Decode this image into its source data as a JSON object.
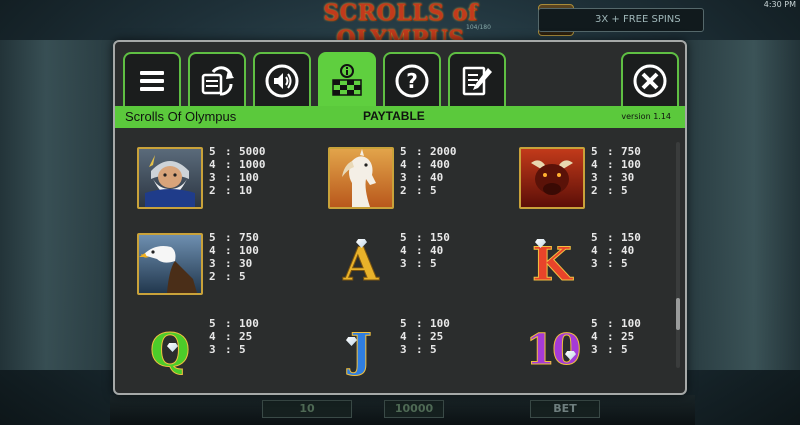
{
  "background": {
    "game_title": "SCROLLS of OLYMPUS",
    "counter": "104/180",
    "free_spins": "3X + FREE SPINS",
    "clock": "4:30 PM",
    "lines_value": "10",
    "credit_value": "10000",
    "bet_label": "BET"
  },
  "toolbar": {
    "menu": "menu-icon",
    "autoplay": "autoplay-icon",
    "sound": "sound-icon",
    "paytable": "paytable-icon",
    "help": "help-icon",
    "history": "history-icon",
    "close": "close-icon"
  },
  "header": {
    "game_name": "Scrolls Of Olympus",
    "section": "PAYTABLE",
    "version": "version 1.14"
  },
  "colors": {
    "accent_green": "#5bc93c",
    "modal_bg": "#2b2d2d",
    "frame_gold": "#c9a23a"
  },
  "paytable": [
    {
      "symbol": "zeus-icon",
      "pays": [
        {
          "count": "5",
          "value": "5000"
        },
        {
          "count": "4",
          "value": "1000"
        },
        {
          "count": "3",
          "value": "100"
        },
        {
          "count": "2",
          "value": "10"
        }
      ]
    },
    {
      "symbol": "pegasus-icon",
      "pays": [
        {
          "count": "5",
          "value": "2000"
        },
        {
          "count": "4",
          "value": "400"
        },
        {
          "count": "3",
          "value": "40"
        },
        {
          "count": "2",
          "value": "5"
        }
      ]
    },
    {
      "symbol": "bull-icon",
      "pays": [
        {
          "count": "5",
          "value": "750"
        },
        {
          "count": "4",
          "value": "100"
        },
        {
          "count": "3",
          "value": "30"
        },
        {
          "count": "2",
          "value": "5"
        }
      ]
    },
    {
      "symbol": "eagle-icon",
      "pays": [
        {
          "count": "5",
          "value": "750"
        },
        {
          "count": "4",
          "value": "100"
        },
        {
          "count": "3",
          "value": "30"
        },
        {
          "count": "2",
          "value": "5"
        }
      ]
    },
    {
      "symbol": "A",
      "pays": [
        {
          "count": "5",
          "value": "150"
        },
        {
          "count": "4",
          "value": "40"
        },
        {
          "count": "3",
          "value": "5"
        }
      ]
    },
    {
      "symbol": "K",
      "pays": [
        {
          "count": "5",
          "value": "150"
        },
        {
          "count": "4",
          "value": "40"
        },
        {
          "count": "3",
          "value": "5"
        }
      ]
    },
    {
      "symbol": "Q",
      "pays": [
        {
          "count": "5",
          "value": "100"
        },
        {
          "count": "4",
          "value": "25"
        },
        {
          "count": "3",
          "value": "5"
        }
      ]
    },
    {
      "symbol": "J",
      "pays": [
        {
          "count": "5",
          "value": "100"
        },
        {
          "count": "4",
          "value": "25"
        },
        {
          "count": "3",
          "value": "5"
        }
      ]
    },
    {
      "symbol": "10",
      "pays": [
        {
          "count": "5",
          "value": "100"
        },
        {
          "count": "4",
          "value": "25"
        },
        {
          "count": "3",
          "value": "5"
        }
      ]
    }
  ]
}
